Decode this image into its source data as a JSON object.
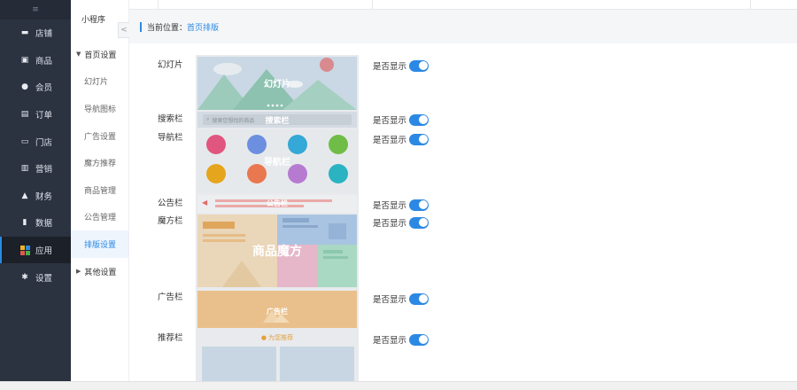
{
  "sidebar": {
    "toggle_glyph": "≡",
    "items": [
      {
        "icon": "store-icon",
        "label": "店铺"
      },
      {
        "icon": "goods-icon",
        "label": "商品"
      },
      {
        "icon": "member-icon",
        "label": "会员"
      },
      {
        "icon": "order-icon",
        "label": "订单"
      },
      {
        "icon": "shop-icon",
        "label": "门店"
      },
      {
        "icon": "marketing-icon",
        "label": "营销"
      },
      {
        "icon": "finance-icon",
        "label": "财务"
      },
      {
        "icon": "data-icon",
        "label": "数据"
      },
      {
        "icon": "apps-icon",
        "label": "应用",
        "active": true
      },
      {
        "icon": "settings-icon",
        "label": "设置"
      }
    ]
  },
  "subnav": {
    "title": "小程序",
    "collapse_glyph": "<",
    "group1": "首页设置",
    "items": [
      "幻灯片",
      "导航图标",
      "广告设置",
      "魔方推荐",
      "商品管理",
      "公告管理",
      "排版设置"
    ],
    "active_index": 6,
    "group2": "其他设置"
  },
  "breadcrumb": {
    "prefix": "当前位置：",
    "current": "首页排版"
  },
  "rows": [
    {
      "key": "slider",
      "label": "幻灯片",
      "toggle_label": "是否显示",
      "on": true
    },
    {
      "key": "search",
      "label": "搜索栏",
      "toggle_label": "是否显示",
      "on": true
    },
    {
      "key": "nav",
      "label": "导航栏",
      "toggle_label": "是否显示",
      "on": true
    },
    {
      "key": "notice",
      "label": "公告栏",
      "toggle_label": "是否显示",
      "on": true
    },
    {
      "key": "cube",
      "label": "魔方栏",
      "toggle_label": "是否显示",
      "on": true
    },
    {
      "key": "ad",
      "label": "广告栏",
      "toggle_label": "是否显示",
      "on": true
    },
    {
      "key": "recommend",
      "label": "推荐栏",
      "toggle_label": "是否显示",
      "on": true
    }
  ],
  "preview": {
    "slider": "幻灯片",
    "search_placeholder": "搜索您想找的商品",
    "search": "搜索栏",
    "nav": "导航栏",
    "notice": "公告栏",
    "cube": "商品魔方",
    "ad": "广告栏",
    "recommend": "为您推荐"
  },
  "colors": {
    "accent": "#2b89e4",
    "sidebar": "#2b3240"
  }
}
